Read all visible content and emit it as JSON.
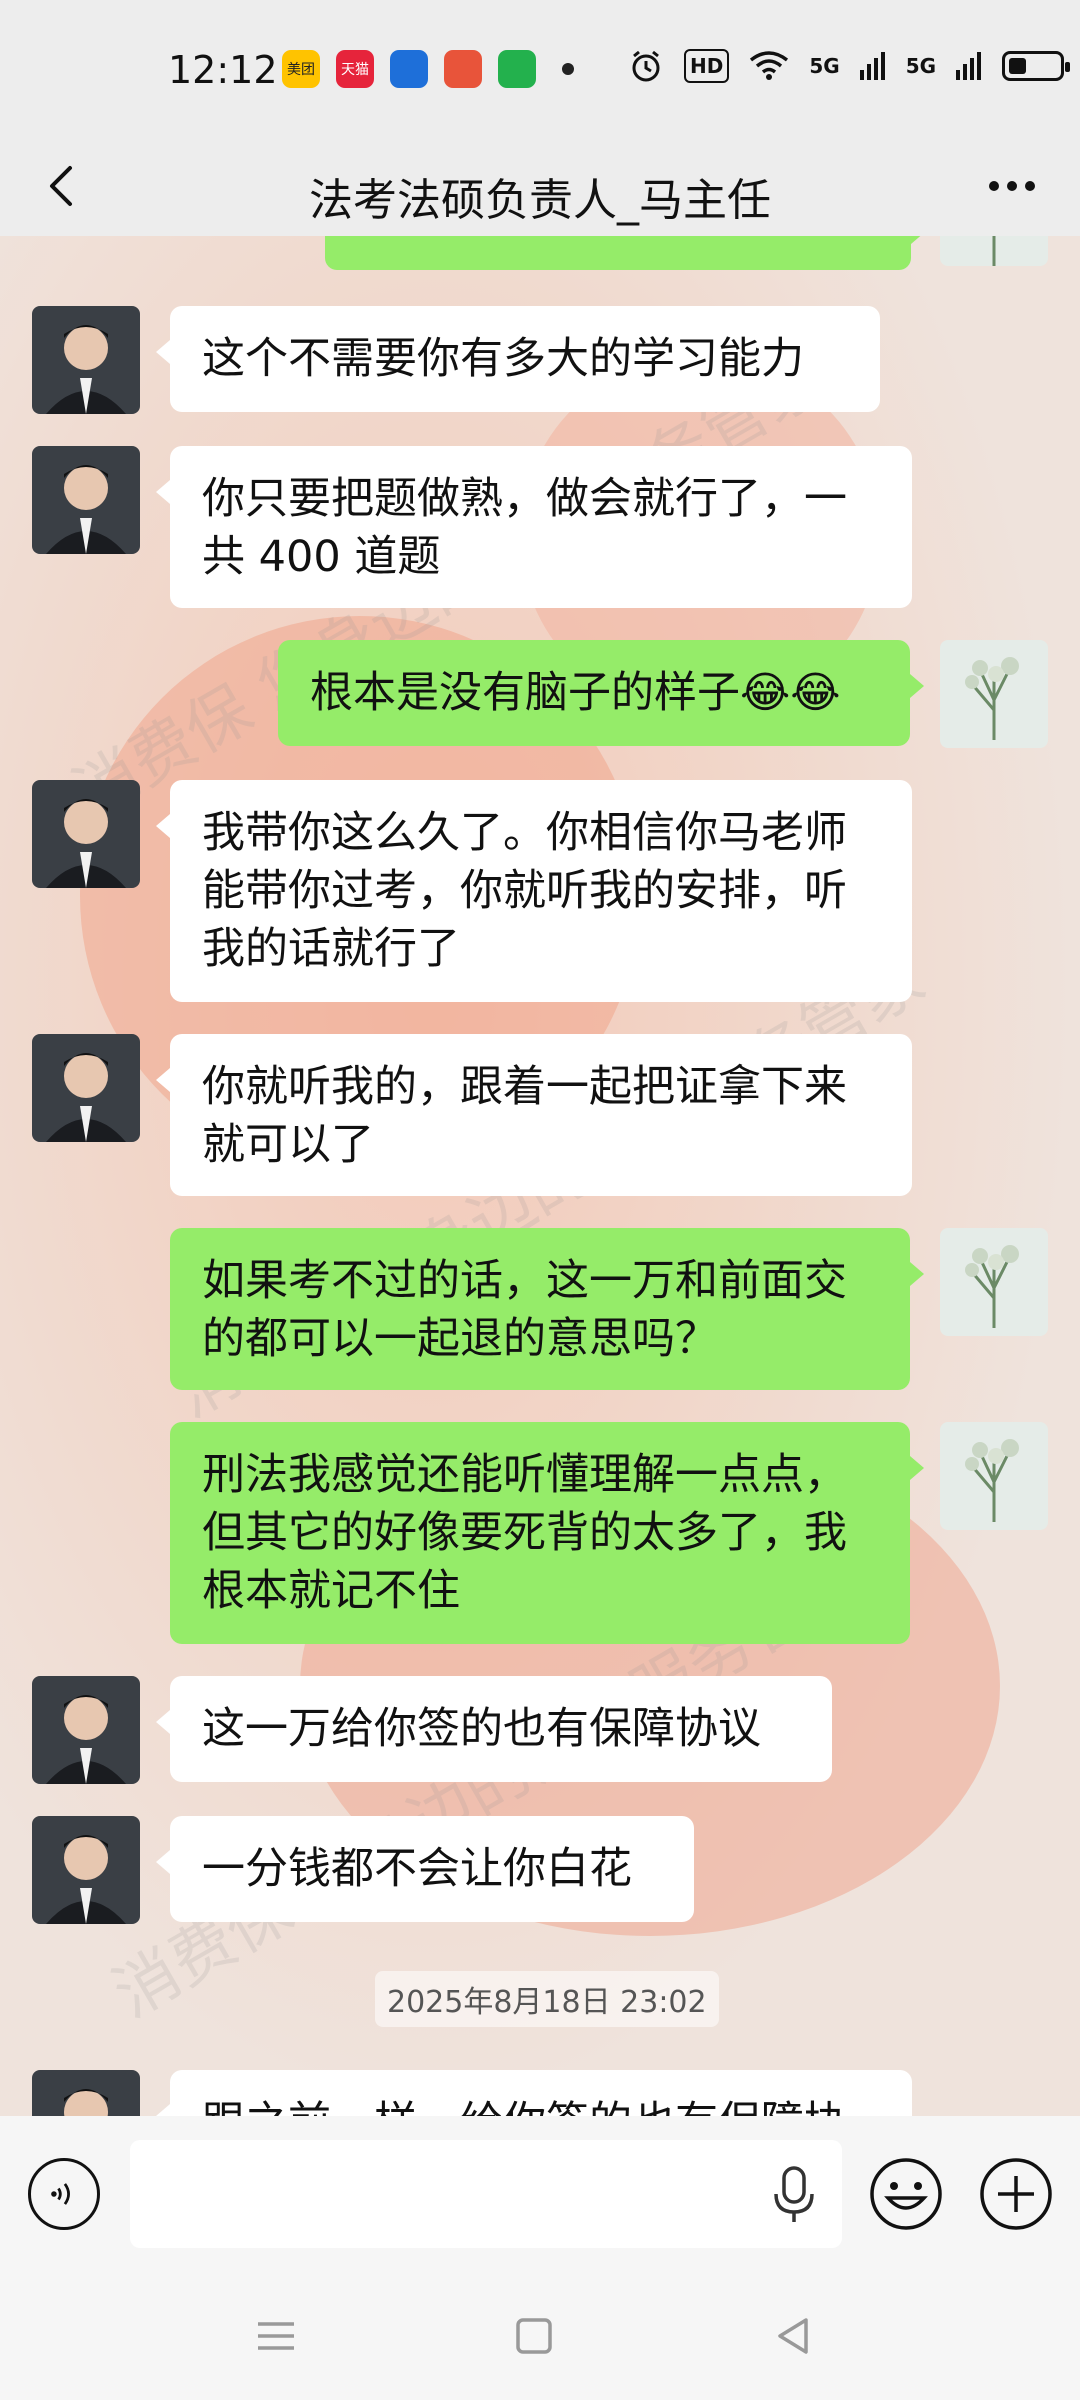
{
  "status_bar": {
    "time": "12:12",
    "apps": [
      {
        "name": "meituan-app-icon",
        "label": "美团",
        "color": "#ffc300"
      },
      {
        "name": "tmall-app-icon",
        "label": "天猫",
        "color": "#e6243b"
      },
      {
        "name": "notification-app-icon",
        "label": "",
        "color": "#1e6fd9"
      },
      {
        "name": "browser-app-icon",
        "label": "",
        "color": "#e8543a"
      },
      {
        "name": "video-app-icon",
        "label": "",
        "color": "#23b14d"
      }
    ],
    "hd_badge": "HD",
    "signal1": "5G",
    "signal2": "5G",
    "battery_level": 0.3
  },
  "header": {
    "title": "法考法硕负责人_马主任"
  },
  "messages": [
    {
      "side": "in",
      "text": "这个不需要你有多大的学习能力"
    },
    {
      "side": "in",
      "text": "你只要把题做熟，做会就行了，一共 400 道题"
    },
    {
      "side": "out",
      "text": "根本是没有脑子的样子😂😂"
    },
    {
      "side": "in",
      "text": "我带你这么久了。你相信你马老师能带你过考，你就听我的安排，听我的话就行了"
    },
    {
      "side": "in",
      "text": "你就听我的，跟着一起把证拿下来就可以了"
    },
    {
      "side": "out",
      "text": "如果考不过的话，这一万和前面交的都可以一起退的意思吗？"
    },
    {
      "side": "out",
      "text": "刑法我感觉还能听懂理解一点点，但其它的好像要死背的太多了，我根本就记不住"
    },
    {
      "side": "in",
      "text": "这一万给你签的也有保障协议"
    },
    {
      "side": "in",
      "text": "一分钱都不会让你白花"
    },
    {
      "side": "in",
      "text": "跟之前一样，给你签的也有保障协"
    }
  ],
  "timestamp": "2025年8月18日 23:02",
  "watermark": "消费保 您身边的消费服务管家",
  "input": {
    "placeholder": ""
  },
  "colors": {
    "incoming": "#ffffff",
    "outgoing": "#95ec69",
    "bar": "#ededed"
  }
}
